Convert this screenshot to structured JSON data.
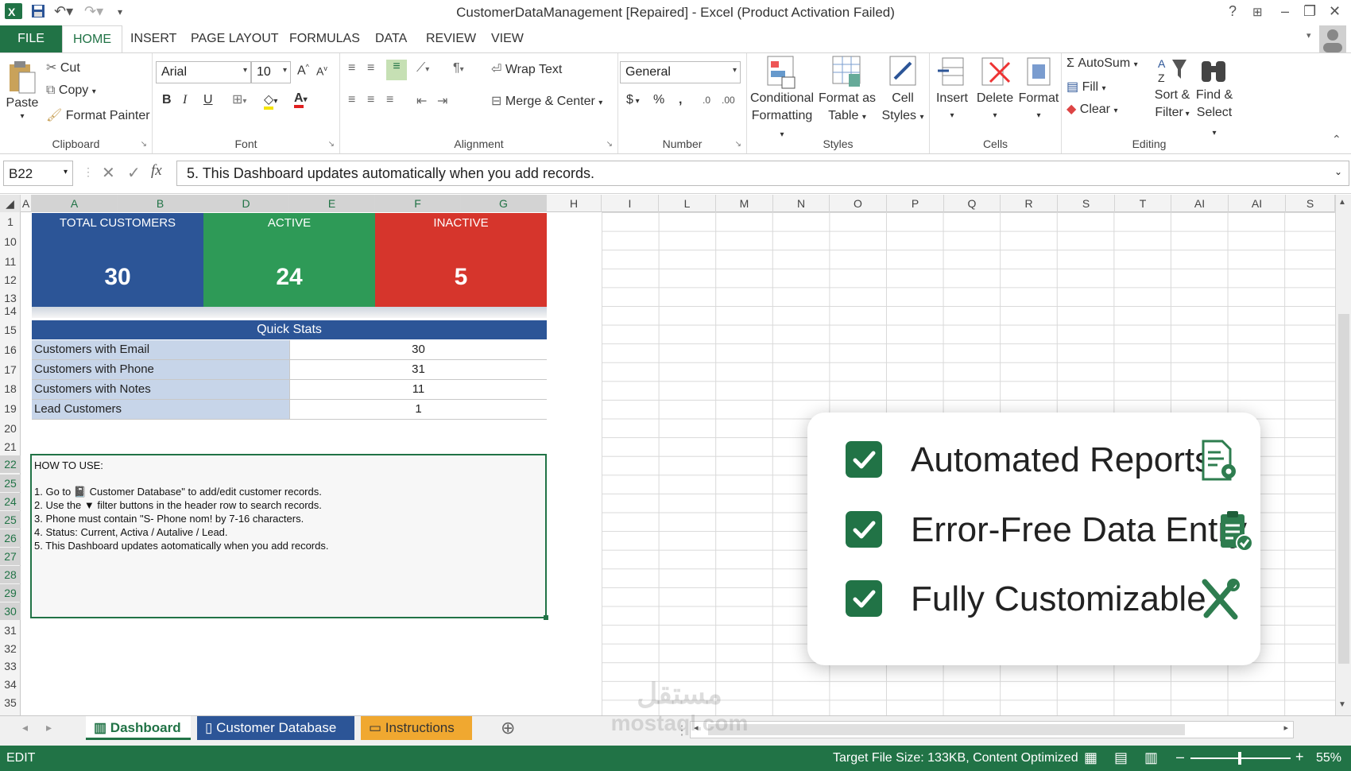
{
  "window": {
    "title": "CustomerDataManagement [Repaired] - Excel (Product Activation Failed)",
    "help": "?",
    "controls": [
      "–",
      "❐",
      "✕"
    ]
  },
  "ribbon_tabs": [
    "FILE",
    "HOME",
    "INSERT",
    "PAGE LAYOUT",
    "FORMULAS",
    "DATA",
    "REVIEW",
    "VIEW"
  ],
  "clipboard": {
    "paste": "Paste",
    "cut": "Cut",
    "copy": "Copy",
    "format_painter": "Format Painter",
    "label": "Clipboard"
  },
  "font": {
    "name": "Arial",
    "size": "10",
    "bold": "B",
    "italic": "I",
    "underline": "U",
    "label": "Font"
  },
  "alignment": {
    "wrap_text": "Wrap Text",
    "merge_center": "Merge & Center",
    "label": "Alignment"
  },
  "number": {
    "format": "General",
    "currency": "$",
    "percent": "%",
    "comma": ",",
    "label": "Number"
  },
  "styles": {
    "conditional": "Conditional",
    "conditional2": "Formatting",
    "format_as": "Format as",
    "format_as2": "Table",
    "cell": "Cell",
    "cell2": "Styles",
    "label": "Styles"
  },
  "cells": {
    "insert": "Insert",
    "delete": "Delete",
    "format": "Format",
    "label": "Cells"
  },
  "editing": {
    "autosum": "AutoSum",
    "fill": "Fill",
    "clear": "Clear",
    "sort": "Sort &",
    "sort2": "Filter",
    "find": "Find &",
    "find2": "Select",
    "label": "Editing"
  },
  "formula_bar": {
    "name_box": "B22",
    "content": "5. This Dashboard updates automatically when you add records."
  },
  "columns": [
    "A",
    "A",
    "B",
    "D",
    "E",
    "F",
    "G",
    "H",
    "I",
    "L",
    "M",
    "N",
    "O",
    "P",
    "Q",
    "R",
    "S",
    "T",
    "AI",
    "AI",
    "S"
  ],
  "rows": [
    "1",
    "10",
    "11",
    "12",
    "13",
    "14",
    "15",
    "16",
    "17",
    "18",
    "19",
    "20",
    "21",
    "22",
    "25",
    "24",
    "25",
    "26",
    "27",
    "28",
    "29",
    "30",
    "31",
    "32",
    "33",
    "34",
    "35"
  ],
  "kpis": [
    {
      "label": "TOTAL CUSTOMERS",
      "value": "30",
      "color": "#2c5597"
    },
    {
      "label": "ACTIVE",
      "value": "24",
      "color": "#2e9a57"
    },
    {
      "label": "INACTIVE",
      "value": "5",
      "color": "#d6352c"
    }
  ],
  "quick_stats": {
    "title": "Quick Stats",
    "rows": [
      {
        "label": "Customers with Email",
        "value": "30"
      },
      {
        "label": "Customers with Phone",
        "value": "31"
      },
      {
        "label": "Customers with Notes",
        "value": "11"
      },
      {
        "label": "Lead Customers",
        "value": "1"
      }
    ]
  },
  "how_to": {
    "title": "HOW TO USE:",
    "lines": [
      "1. Go to 📓 Customer Database\" to add/edit customer records.",
      "2. Use the ▼ filter buttons in the header row to search records.",
      "3. Phone must contain \"S- Phone nom! by 7-16 characters.",
      "4. Status: Current, Activa / Autalive / Lead.",
      "5. This Dashboard updates aotomatically when you add records."
    ]
  },
  "features": [
    {
      "text": "Automated Reports",
      "icon": "report-gear-icon"
    },
    {
      "text": "Error-Free Data Entry",
      "icon": "clipboard-check-icon"
    },
    {
      "text": "Fully Customizable",
      "icon": "tools-icon"
    }
  ],
  "sheet_tabs": [
    {
      "label": "Dashboard",
      "color": "#ffffff"
    },
    {
      "label": "Customer Database",
      "color": "#2c5597"
    },
    {
      "label": "Instructions",
      "color": "#f0a830"
    }
  ],
  "status": {
    "mode": "EDIT",
    "info": "Target File Size: 133KB, Content Optimized",
    "zoom": "55%"
  },
  "watermark": {
    "line1": "مستقل",
    "line2": "mostaql.com"
  },
  "colors": {
    "excel_green": "#217346",
    "blue": "#2c5597",
    "green": "#2e9a57",
    "red": "#d6352c"
  }
}
